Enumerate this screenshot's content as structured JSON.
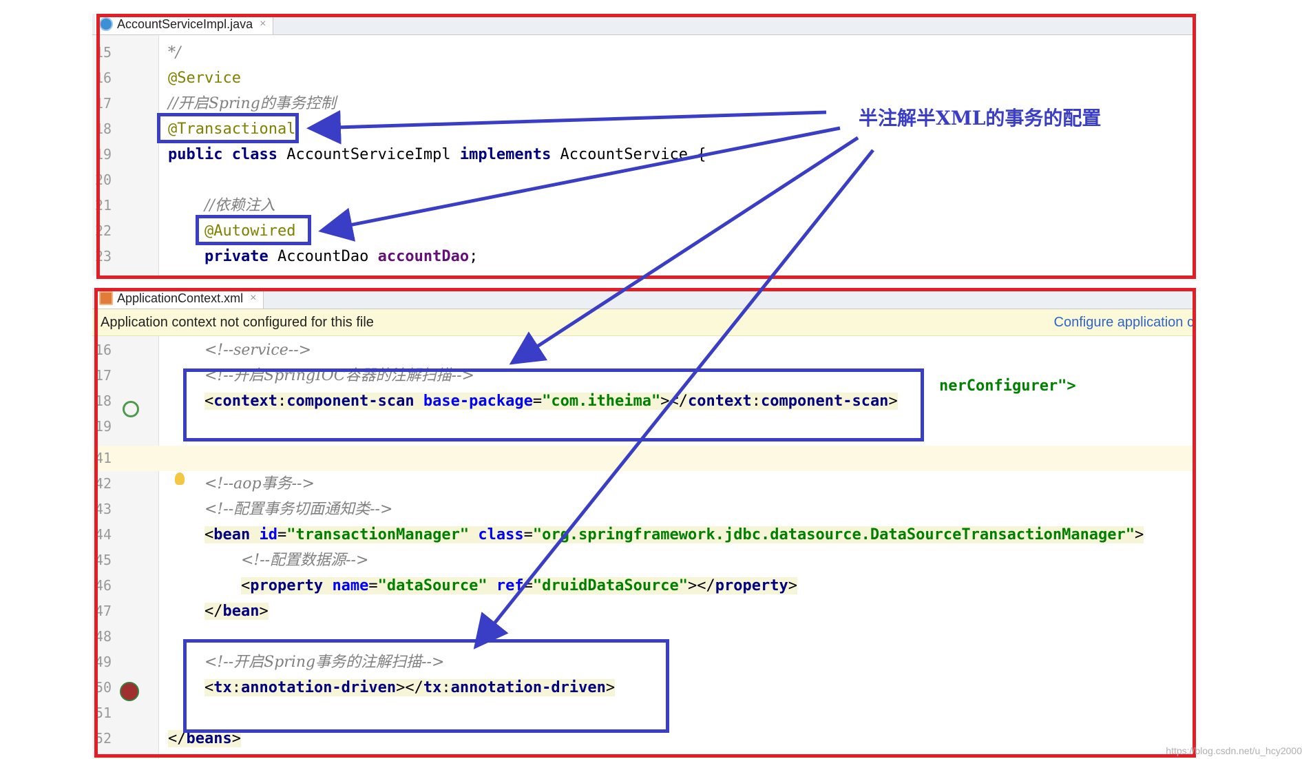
{
  "java_editor": {
    "tab_label": "AccountServiceImpl.java",
    "tab_close": "×",
    "lines": [
      {
        "num": "15",
        "html": "<span class='cmt'>*/</span>"
      },
      {
        "num": "16",
        "html": "<span class='ann'>@Service</span>"
      },
      {
        "num": "17",
        "html": "<span class='cmt'>//开启Spring的事务控制</span>"
      },
      {
        "num": "18",
        "html": "<span class='ann'>@Transactional</span>"
      },
      {
        "num": "19",
        "html": "<span class='kw'>public class</span> AccountServiceImpl <span class='kw'>implements</span> AccountService {"
      },
      {
        "num": "20",
        "html": ""
      },
      {
        "num": "21",
        "html": "    <span class='cmt'>//依赖注入</span>"
      },
      {
        "num": "22",
        "html": "    <span class='ann'>@Autowired</span>"
      },
      {
        "num": "23",
        "html": "    <span class='kw'>private</span> AccountDao <span class='fld'>accountDao</span>;"
      }
    ]
  },
  "xml_editor": {
    "tab_label": "ApplicationContext.xml",
    "tab_close": "×",
    "banner_message": "Application context not configured for this file",
    "banner_link": "Configure application c",
    "lines": [
      {
        "num": "16",
        "html": "    <span class='cmt'>&lt;!--service--&gt;</span>"
      },
      {
        "num": "17",
        "html": "    <span class='cmt'>&lt;!--开启SpringIOC容器的注解扫描--&gt;</span>"
      },
      {
        "num": "18",
        "html": "    <span class='xmlbg'>&lt;<span class='tag'>context</span>:<span class='tag'>component-scan</span> <span class='attr'>base-package</span>=<span class='str'>\"com.itheima\"</span>&gt;&lt;/<span class='tag'>context</span>:<span class='tag'>component-scan</span>&gt;</span>"
      },
      {
        "num": "19",
        "html": ""
      },
      {
        "num": "41",
        "html": ""
      },
      {
        "num": "42",
        "html": "    <span class='cmt'>&lt;!--aop事务--&gt;</span>"
      },
      {
        "num": "43",
        "html": "    <span class='cmt'>&lt;!--配置事务切面通知类--&gt;</span>"
      },
      {
        "num": "44",
        "html": "    <span class='xmlbg'>&lt;<span class='tag'>bean</span> <span class='attr'>id</span>=<span class='str'>\"transactionManager\"</span> <span class='attr'>class</span>=<span class='str'>\"org.springframework.jdbc.datasource.DataSourceTransactionManager\"</span>&gt;</span>"
      },
      {
        "num": "45",
        "html": "        <span class='cmt'>&lt;!--配置数据源--&gt;</span>"
      },
      {
        "num": "46",
        "html": "        <span class='xmlbg'>&lt;<span class='tag'>property</span> <span class='attr'>name</span>=<span class='str'>\"dataSource\"</span> <span class='attr'>ref</span>=<span class='str'>\"druidDataSource\"</span>&gt;&lt;/<span class='tag'>property</span>&gt;</span>"
      },
      {
        "num": "47",
        "html": "    <span class='xmlbg'>&lt;/<span class='tag'>bean</span>&gt;</span>"
      },
      {
        "num": "48",
        "html": ""
      },
      {
        "num": "49",
        "html": "    <span class='cmt'>&lt;!--开启Spring事务的注解扫描--&gt;</span>"
      },
      {
        "num": "50",
        "html": "    <span class='xmlbg'>&lt;<span class='tag'>tx</span>:<span class='tag'>annotation-driven</span>&gt;&lt;/<span class='tag'>tx</span>:<span class='tag'>annotation-driven</span>&gt;</span>"
      },
      {
        "num": "51",
        "html": ""
      },
      {
        "num": "52",
        "html": "<span class='xmlbg'>&lt;/<span class='tag'>beans</span>&gt;</span>"
      }
    ],
    "hidden_fragment": "nerConfigurer\">"
  },
  "callout": {
    "text": "半注解半XML的事务的配置"
  },
  "watermark": "https://blog.csdn.net/u_hcy2000",
  "colors": {
    "red_box": "#e31e24",
    "blue_box": "#3a3ec7"
  }
}
